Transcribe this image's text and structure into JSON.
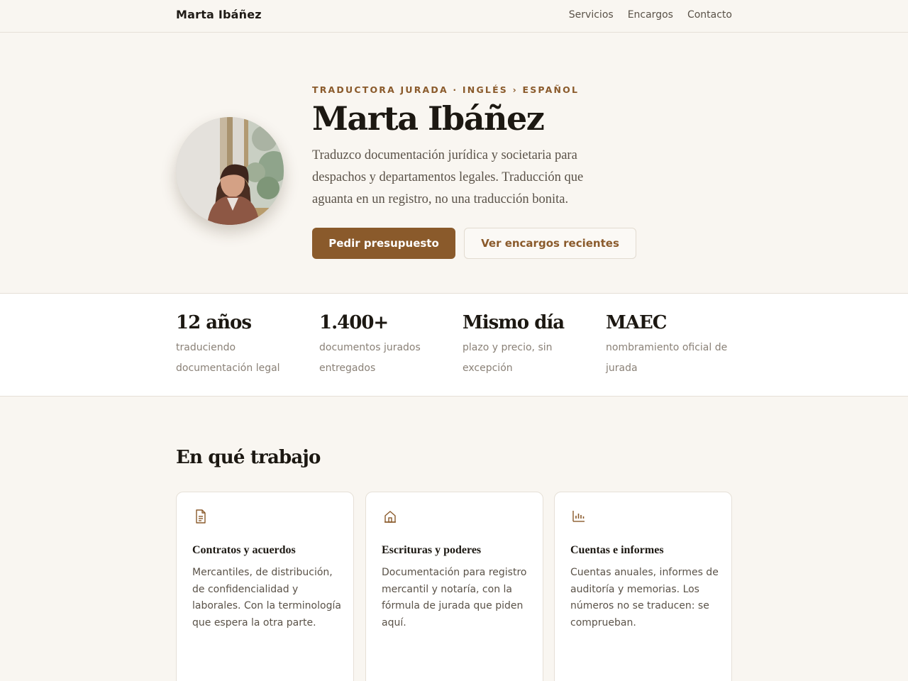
{
  "header": {
    "brand": "Marta Ibáñez",
    "nav": [
      "Servicios",
      "Encargos",
      "Contacto"
    ]
  },
  "hero": {
    "eyebrow": "TRADUCTORA JURADA · INGLÉS › ESPAÑOL",
    "title": "Marta Ibáñez",
    "description": "Traduzco documentación jurídica y societaria para despachos y departamentos legales. Traducción que aguanta en un registro, no una traducción bonita.",
    "primary_cta": "Pedir presupuesto",
    "secondary_cta": "Ver encargos recientes"
  },
  "stats": [
    {
      "value": "12 años",
      "label": "traduciendo documentación legal"
    },
    {
      "value": "1.400+",
      "label": "documentos jurados entregados"
    },
    {
      "value": "Mismo día",
      "label": "plazo y precio, sin excepción"
    },
    {
      "value": "MAEC",
      "label": "nombramiento oficial de jurada"
    }
  ],
  "services": {
    "title": "En qué trabajo",
    "items": [
      {
        "icon": "document-icon",
        "title": "Contratos y acuerdos",
        "text": "Mercantiles, de distribución, de confidencialidad y laborales. Con la terminología que espera la otra parte."
      },
      {
        "icon": "building-icon",
        "title": "Escrituras y poderes",
        "text": "Documentación para registro mercantil y notaría, con la fórmula de jurada que piden aquí."
      },
      {
        "icon": "bar-chart-icon",
        "title": "Cuentas e informes",
        "text": "Cuentas anuales, informes de auditoría y memorias. Los números no se traducen: se comprueban."
      }
    ]
  },
  "colors": {
    "accent": "#8a5a2b",
    "background": "#f9f6f1",
    "text": "#1f1b16"
  }
}
